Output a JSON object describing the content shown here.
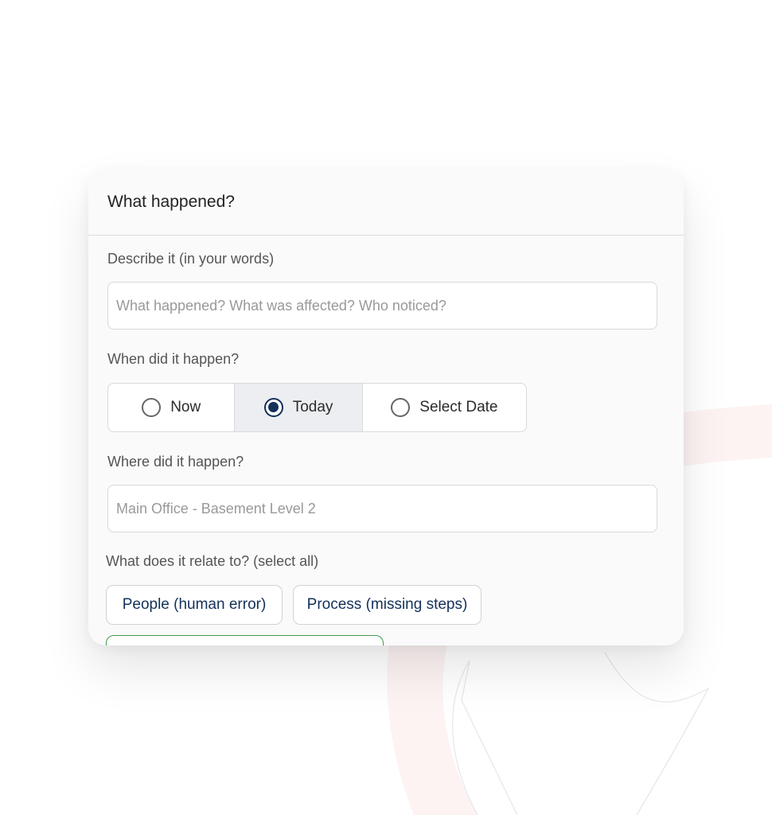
{
  "card": {
    "title": "What happened?"
  },
  "describe": {
    "label": "Describe it (in your words)",
    "placeholder": "What happened? What was affected? Who noticed?"
  },
  "when": {
    "label": "When did it happen?",
    "options": [
      {
        "label": "Now",
        "selected": false
      },
      {
        "label": "Today",
        "selected": true
      },
      {
        "label": "Select Date",
        "selected": false
      }
    ]
  },
  "where": {
    "label": "Where did it happen?",
    "placeholder": "Main Office - Basement Level 2"
  },
  "relates": {
    "label": "What does it relate to? (select all)",
    "chips": [
      "People (human error)",
      "Process (missing steps)"
    ]
  },
  "colors": {
    "accent": "#14305a",
    "chip_selected_border": "#3f9a4a"
  }
}
